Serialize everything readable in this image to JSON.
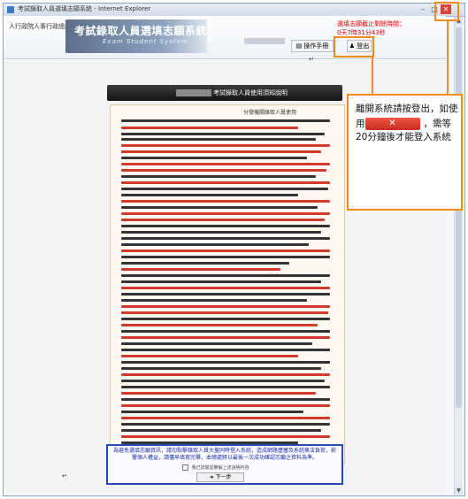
{
  "window": {
    "title": "考試錄取人員選填志願系統 - Internet Explorer"
  },
  "header": {
    "logo": "人行政院人事行政總處",
    "system_title": "考試錄取人員選填志願系統",
    "system_subtitle": "Exam Student System",
    "warning_line1": "選填志願截止剩餘時間：",
    "warning_line2": "0天7時31分43秒",
    "manual_button": "操作手冊",
    "logout_button": "登出"
  },
  "main": {
    "ribbon_title": "考試錄取人員使用須知說明",
    "doc_header": "分發機關錄取人員使用"
  },
  "callout": {
    "text1": "離開系統請按登出，如使用",
    "close_label": "✕",
    "text2": "，需等20分鐘後才能登入系統"
  },
  "bottom": {
    "notice": "為避免選填志願資訊，請勿點擊錄取人員大量同時登入系統，造成網路壅塞及系統無法負荷，影響個人權益，請儘早填寫完畢，本總處將以最後一次成功確認志願之資料為準。",
    "checkbox_label": "我已詳閱並瞭解上述說明內容",
    "next_button": "下一步"
  }
}
